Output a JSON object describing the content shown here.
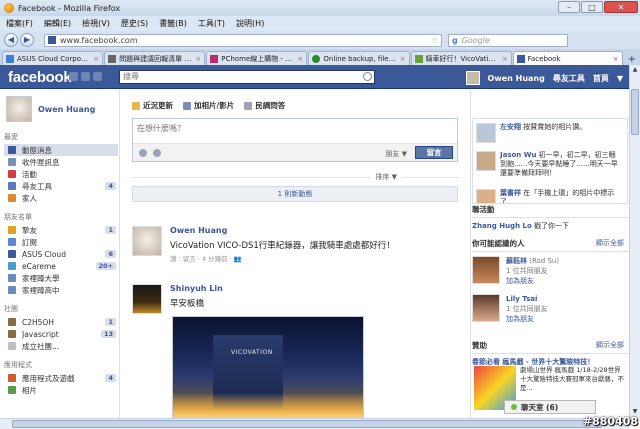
{
  "window": {
    "title": "Facebook - Mozilla Firefox",
    "min": "–",
    "max": "□",
    "close": "✕"
  },
  "menu": [
    "檔案(F)",
    "編輯(E)",
    "檢視(V)",
    "歷史(S)",
    "書籤(B)",
    "工具(T)",
    "說明(H)"
  ],
  "nav": {
    "back": "◀",
    "forward": "▶",
    "url": "www.facebook.com",
    "search_engine": "g",
    "search_placeholder": "Google"
  },
  "tabs": [
    {
      "label": "ASUS Cloud Corpora...",
      "color": "#3b7dd8"
    },
    {
      "label": "問題與建議回報清單 - ...",
      "color": "#666"
    },
    {
      "label": "PChome線上購物 - 2...",
      "color": "#c0286d"
    },
    {
      "label": "Online backup, file sy...",
      "color": "#2a8a2a"
    },
    {
      "label": "騎車好行！VicoVatio...",
      "color": "#6aa03a"
    },
    {
      "label": "Facebook",
      "color": "#3b5998",
      "active": true
    }
  ],
  "tab_close": "×",
  "tab_new": "+",
  "facebook": {
    "logo": "facebook",
    "search_placeholder": "搜尋",
    "user_name": "Owen Huang",
    "find_friends": "尋友工具",
    "home": "首頁",
    "arrow": "▼"
  },
  "sidebar": {
    "profile_name": "Owen Huang",
    "fav_label": "最愛",
    "favorites": [
      {
        "label": "動態消息",
        "color": "#3b5998",
        "selected": true
      },
      {
        "label": "收件匣訊息",
        "color": "#7a8fb8"
      },
      {
        "label": "活動",
        "color": "#d04040"
      },
      {
        "label": "尋友工具",
        "count": "4",
        "color": "#5a7ac0"
      },
      {
        "label": "家人",
        "color": "#e08a30"
      }
    ],
    "friends_label": "朋友名單",
    "friends": [
      {
        "label": "摯友",
        "count": "1",
        "color": "#e0a020"
      },
      {
        "label": "訂閱",
        "color": "#5a8ad0"
      },
      {
        "label": "ASUS Cloud",
        "count": "6",
        "color": "#3b5998"
      },
      {
        "label": "eCareme",
        "count": "20+",
        "color": "#4a9ad0"
      },
      {
        "label": "家裡蹲大學",
        "color": "#6a8ac0"
      },
      {
        "label": "家裡蹲高中",
        "color": "#6a8ac0"
      }
    ],
    "groups_label": "社團",
    "groups": [
      {
        "label": "C2H5OH",
        "count": "1",
        "color": "#8a6a40"
      },
      {
        "label": "Javascript",
        "count": "13",
        "color": "#8a6a40"
      },
      {
        "label": "成立社團...",
        "color": "#c0c0c0"
      }
    ],
    "apps_label": "應用程式",
    "apps": [
      {
        "label": "應用程式及遊戲",
        "count": "4",
        "color": "#d05a2a"
      },
      {
        "label": "相片",
        "color": "#5a9a4a"
      }
    ]
  },
  "feed": {
    "tab_status": "近況更新",
    "tab_photo": "加相片/影片",
    "tab_question": "民調問答",
    "composer_placeholder": "在想什麼嗎？",
    "audience": "朋友 ▼",
    "post_button": "留言",
    "sort_label": "排序 ▼",
    "new_stories": "1 則新動態",
    "stories": [
      {
        "name": "Owen Huang",
        "text": "VicoVation VICO-DS1行車紀錄器，讓我騎車處處都好行！",
        "meta": "讚 · 留言 · 4 分鐘前 · 👥"
      },
      {
        "name": "Shinyuh Lin",
        "text": "早安板橋",
        "meta": ""
      }
    ],
    "photo_sign": "VICOVATION"
  },
  "right": {
    "ticker": [
      {
        "text": "<b>左安翔</b>按贊賞她的相片讚。"
      },
      {
        "text": "<b>Jason Wu</b> 初一早，初二早，初三睏到飽......今天要早點睡了......明天一早還要準備拜拜咧！"
      },
      {
        "text": "<b>葉書祥</b>在「手機上環」的相片中標示了..."
      }
    ],
    "events_label": "聯活動",
    "event_text": "<b>Zhang Hugh Lo</b> 戳了你一下",
    "pymk_label": "你可能認識的人",
    "pymk_all": "顯示全部",
    "people": [
      {
        "name": "蘇鈺林",
        "sub": "(Rod Su)",
        "mutual": "1 位共同朋友",
        "add": "加為朋友"
      },
      {
        "name": "Lily Tsai",
        "sub": "",
        "mutual": "1 位共同朋友",
        "add": "加為朋友"
      }
    ],
    "sponsored_label": "贊助",
    "sponsored_all": "顯示全部",
    "ad_title": "春節必看 瘋馬戲 - 世界十大驚險特技！",
    "ad_text": "劇場山世界 瘋馬戲 1/18-2/28世界十大驚險特技大賽冠軍來台獻藝，不是..."
  },
  "chat": {
    "label": "聊天室 (6)"
  },
  "watermark": "#880408"
}
